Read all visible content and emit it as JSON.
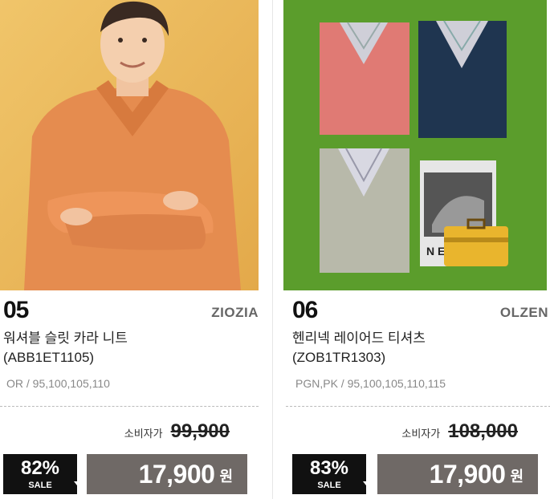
{
  "products": [
    {
      "number": "05",
      "brand": "ZIOZIA",
      "name_line1": "워셔블 슬릿 카라 니트",
      "name_line2": "(ABB1ET1105)",
      "options": "OR / 95,100,105,110",
      "original_label": "소비자가",
      "original_price": "99,900",
      "discount": "82%",
      "sale_label": "SALE",
      "price": "17,900",
      "currency": "원"
    },
    {
      "number": "06",
      "brand": "OLZEN",
      "name_line1": "헨리넥 레이어드 티셔츠",
      "name_line2": "(ZOB1TR1303)",
      "options": "PGN,PK / 95,100,105,110,115",
      "original_label": "소비자가",
      "original_price": "108,000",
      "discount": "83%",
      "sale_label": "SALE",
      "price": "17,900",
      "currency": "원"
    }
  ],
  "colors": {
    "price_bg": "#6f6966",
    "sale_bg": "#111111",
    "photo1_bg": "#e8b85a",
    "photo2_bg": "#5a9a2a"
  }
}
